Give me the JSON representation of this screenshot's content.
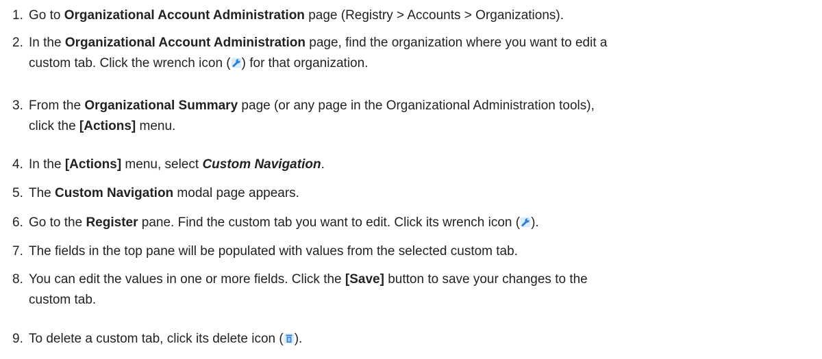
{
  "steps": [
    {
      "number": "1.",
      "t1": "Go to ",
      "b1": "Organizational Account Administration",
      "t2": " page (Registry > Accounts > Organizations)."
    },
    {
      "number": "2.",
      "t1": "In the ",
      "b1": "Organizational Account Administration",
      "t2": " page, find the organization where you want to edit a",
      "t3": "custom tab. Click the wrench icon (",
      "t4": ") for that organization."
    },
    {
      "number": "3.",
      "t1": "From the ",
      "b1": "Organizational Summary",
      "t2": " page (or any page in the Organizational Administration tools),",
      "t3": "click the ",
      "b2": "[Actions]",
      "t4": " menu."
    },
    {
      "number": "4.",
      "t1": "In the ",
      "b1": "[Actions]",
      "t2": " menu, select ",
      "i1": "Custom Navigation",
      "t3": "."
    },
    {
      "number": "5.",
      "t1": "The ",
      "b1": "Custom Navigation",
      "t2": " modal page appears."
    },
    {
      "number": "6.",
      "t1": "Go to the ",
      "b1": "Register",
      "t2": " pane. Find the custom tab you want to edit. Click its wrench icon (",
      "t3": ")."
    },
    {
      "number": "7.",
      "t1": "The fields in the top pane will be populated with values from the selected custom tab."
    },
    {
      "number": "8.",
      "t1": "You can edit the values in one or more fields. Click the ",
      "b1": "[Save]",
      "t2": " button to save your changes to the",
      "t3": "custom tab."
    },
    {
      "number": "9.",
      "t1": "To delete a custom tab, click its delete icon (",
      "t2": ")."
    }
  ],
  "icons": {
    "wrench": "wrench-icon",
    "delete": "trash-icon"
  },
  "colors": {
    "text": "#222222",
    "icon_blue": "#2f7fd8",
    "icon_light": "#9cc9f2"
  }
}
